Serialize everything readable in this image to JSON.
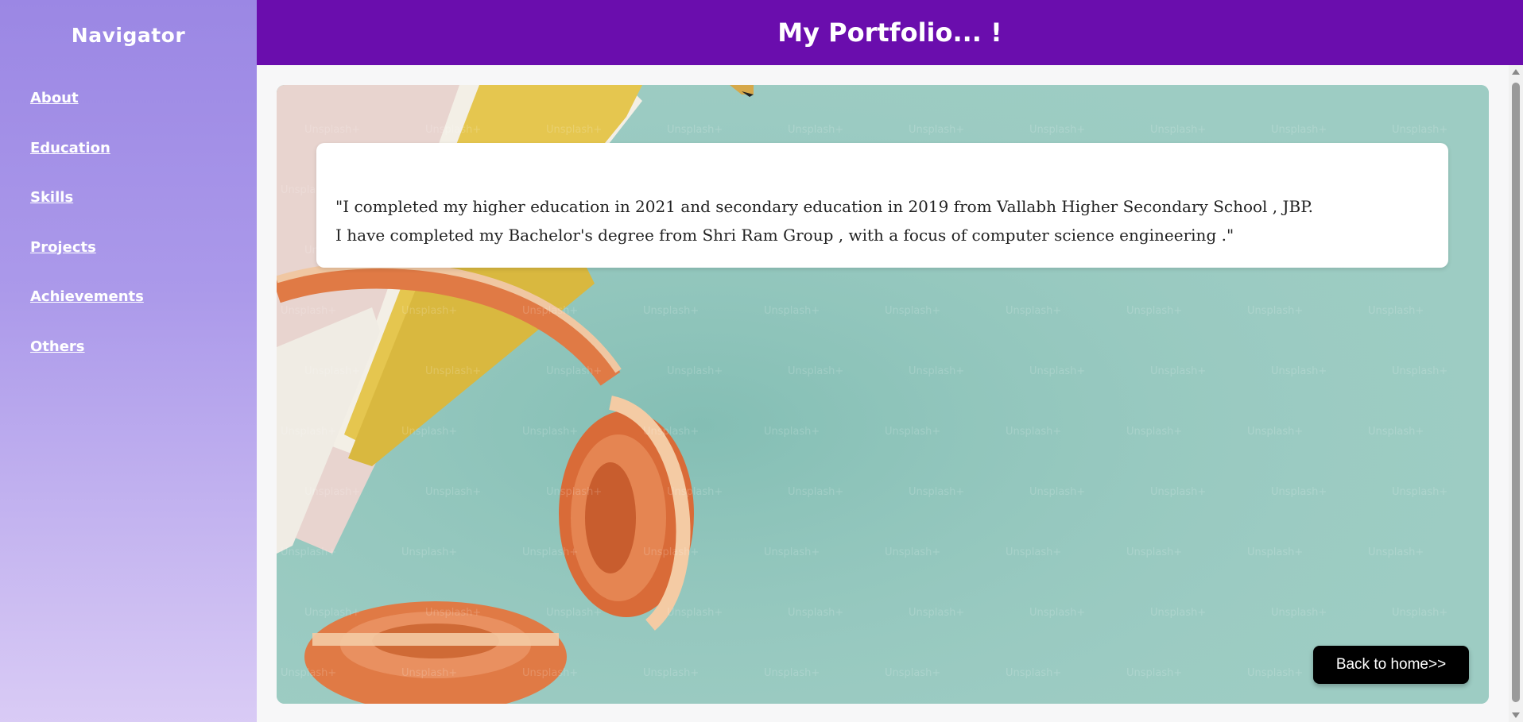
{
  "sidebar": {
    "title": "Navigator",
    "items": [
      {
        "label": "About"
      },
      {
        "label": "Education"
      },
      {
        "label": "Skills"
      },
      {
        "label": "Projects"
      },
      {
        "label": "Achievements"
      },
      {
        "label": "Others"
      }
    ]
  },
  "header": {
    "title": "My Portfolio... !"
  },
  "main": {
    "card_lines": [
      "\"I completed my higher education in 2021 and secondary education in 2019 from Vallabh Higher Secondary School , JBP.",
      "I have completed my Bachelor's degree from Shri Ram Group , with a focus of computer science engineering .\""
    ],
    "home_button": "Back to home>>",
    "watermark_text": "Unsplash+"
  },
  "colors": {
    "header_bg": "#6a0dad",
    "panel_bg": "#9dccc3",
    "headphone": "#e07a45"
  }
}
